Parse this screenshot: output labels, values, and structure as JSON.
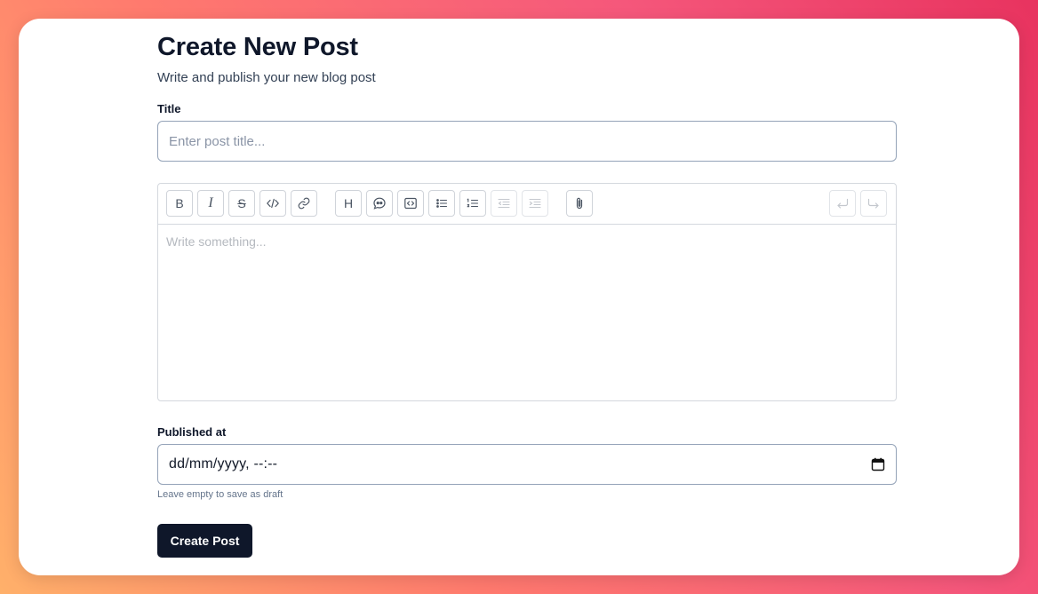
{
  "header": {
    "title": "Create New Post",
    "subtitle": "Write and publish your new blog post"
  },
  "title_field": {
    "label": "Title",
    "placeholder": "Enter post title...",
    "value": ""
  },
  "editor": {
    "placeholder": "Write something...",
    "toolbar": [
      {
        "name": "bold",
        "icon": "bold-icon",
        "glyph": "B",
        "enabled": true
      },
      {
        "name": "italic",
        "icon": "italic-icon",
        "glyph": "I",
        "enabled": true
      },
      {
        "name": "strikethrough",
        "icon": "strikethrough-icon",
        "glyph": "S",
        "enabled": true
      },
      {
        "name": "code",
        "icon": "code-icon",
        "enabled": true
      },
      {
        "name": "link",
        "icon": "link-icon",
        "enabled": true
      },
      {
        "name": "heading",
        "icon": "heading-icon",
        "glyph": "H",
        "enabled": true
      },
      {
        "name": "quote",
        "icon": "quote-icon",
        "enabled": true
      },
      {
        "name": "code-block",
        "icon": "code-block-icon",
        "enabled": true
      },
      {
        "name": "bullet-list",
        "icon": "bullet-list-icon",
        "enabled": true
      },
      {
        "name": "ordered-list",
        "icon": "ordered-list-icon",
        "enabled": true
      },
      {
        "name": "outdent",
        "icon": "outdent-icon",
        "enabled": false
      },
      {
        "name": "indent",
        "icon": "indent-icon",
        "enabled": false
      },
      {
        "name": "attach",
        "icon": "paperclip-icon",
        "enabled": true
      },
      {
        "name": "undo",
        "icon": "undo-icon",
        "enabled": false
      },
      {
        "name": "redo",
        "icon": "redo-icon",
        "enabled": false
      }
    ]
  },
  "published_field": {
    "label": "Published at",
    "value": "dd/mm/yyyy, --:--",
    "icon": "calendar-icon",
    "hint": "Leave empty to save as draft"
  },
  "submit": {
    "label": "Create Post"
  },
  "colors": {
    "primary": "#0f172a",
    "muted": "#64748b",
    "border": "#94a3b8"
  }
}
